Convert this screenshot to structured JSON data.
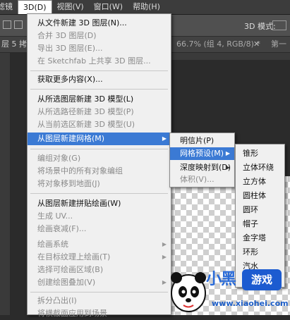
{
  "menubar": {
    "items": [
      "滤镜",
      "3D(D)",
      "视图(V)",
      "窗口(W)",
      "帮助(H)"
    ],
    "active_index": 1
  },
  "toolbar": {
    "mode_label": "3D 模式:"
  },
  "doc_tabs": {
    "left_tab": "层 5 拷贝",
    "right_tab": "66.7% (组 4, RGB/8) *",
    "close_glyph": "✕",
    "extra_tab": "第一"
  },
  "menu_3d": {
    "items": [
      {
        "label": "从文件新建 3D 图层(N)...",
        "enabled": true
      },
      {
        "label": "合并 3D 图层(D)",
        "enabled": false
      },
      {
        "label": "导出 3D 图层(E)...",
        "enabled": false
      },
      {
        "label": "在 Sketchfab 上共享 3D 图层...",
        "enabled": false
      },
      {
        "label": "获取更多内容(X)...",
        "enabled": true
      },
      {
        "label": "从所选图层新建 3D 模型(L)",
        "enabled": true
      },
      {
        "label": "从所选路径新建 3D 模型(P)",
        "enabled": false
      },
      {
        "label": "从当前选区新建 3D 模型(U)",
        "enabled": false
      },
      {
        "label": "从图层新建网格(M)",
        "enabled": true,
        "highlighted": true,
        "submenu": true
      },
      {
        "label": "编组对象(G)",
        "enabled": false
      },
      {
        "label": "将场景中的所有对象编组",
        "enabled": false
      },
      {
        "label": "将对象移到地面(J)",
        "enabled": false
      },
      {
        "label": "从图层新建拼贴绘画(W)",
        "enabled": true
      },
      {
        "label": "生成 UV...",
        "enabled": false
      },
      {
        "label": "绘画衰减(F)...",
        "enabled": false
      },
      {
        "label": "绘画系统",
        "enabled": false,
        "submenu": true
      },
      {
        "label": "在目标纹理上绘画(T)",
        "enabled": false,
        "submenu": true
      },
      {
        "label": "选择可绘画区域(B)",
        "enabled": false
      },
      {
        "label": "创建绘图叠加(V)",
        "enabled": false,
        "submenu": true
      },
      {
        "label": "拆分凸出(I)",
        "enabled": false
      },
      {
        "label": "将横截面应用到场景",
        "enabled": false
      }
    ]
  },
  "menu_mesh": {
    "items": [
      {
        "label": "明信片(P)",
        "enabled": true
      },
      {
        "label": "网格预设(M)",
        "enabled": true,
        "highlighted": true,
        "submenu": true
      },
      {
        "label": "深度映射到(D)",
        "enabled": true,
        "submenu": true
      },
      {
        "label": "体积(V)...",
        "enabled": false
      }
    ]
  },
  "menu_preset": {
    "items": [
      "锥形",
      "立体环绕",
      "立方体",
      "圆柱体",
      "圆环",
      "帽子",
      "金字塔",
      "环形",
      "汽水",
      "球体"
    ]
  },
  "watermark": {
    "title": "小黑",
    "badge": "游戏",
    "url": "www.xiaohei.com"
  },
  "colors": {
    "highlight": "#3b7ad4",
    "menu_bg": "#f0f0f0",
    "disabled_text": "#8a8a8a",
    "app_bg": "#2b2b2b"
  }
}
